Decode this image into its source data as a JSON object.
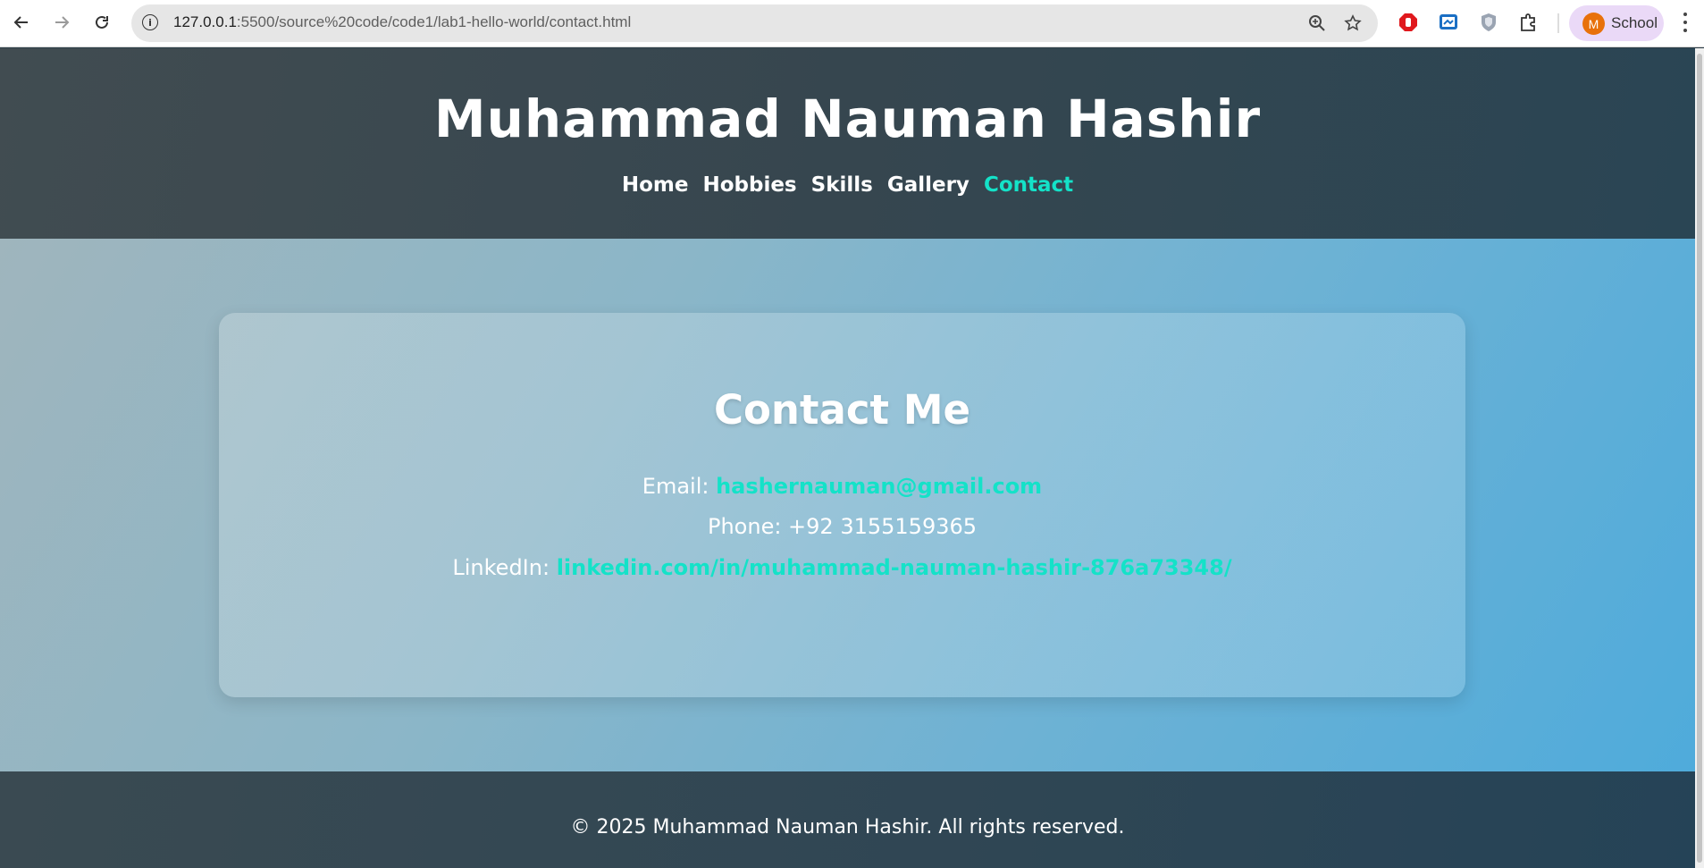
{
  "browser": {
    "url_host": "127.0.0.1",
    "url_path": ":5500/source%20code/code1/lab1-hello-world/contact.html",
    "profile_initial": "M",
    "profile_name": "School",
    "icons": [
      "back-icon",
      "forward-icon",
      "reload-icon",
      "site-info-icon",
      "zoom-icon",
      "bookmark-star-icon",
      "adblock-extension-icon",
      "screen-extension-icon",
      "shield-extension-icon",
      "extensions-puzzle-icon",
      "menu-dots-icon"
    ]
  },
  "header": {
    "title": "Muhammad Nauman Hashir",
    "nav": [
      {
        "label": "Home",
        "active": false
      },
      {
        "label": "Hobbies",
        "active": false
      },
      {
        "label": "Skills",
        "active": false
      },
      {
        "label": "Gallery",
        "active": false
      },
      {
        "label": "Contact",
        "active": true
      }
    ]
  },
  "contact": {
    "title": "Contact Me",
    "email_label": "Email:",
    "email": "hashernauman@gmail.com",
    "phone_label": "Phone: +92 3155159365",
    "linkedin_label": "LinkedIn:",
    "linkedin": "linkedin.com/in/muhammad-nauman-hashir-876a73348/"
  },
  "footer": {
    "text": "© 2025 Muhammad Nauman Hashir. All rights reserved."
  },
  "colors": {
    "accent": "#14e2c8",
    "header_bg": "#36464f",
    "footer_bg": "#2f4654",
    "main_gradient_start": "#9fb5bd",
    "main_gradient_end": "#4fabdb",
    "profile_avatar": "#e8710a"
  }
}
